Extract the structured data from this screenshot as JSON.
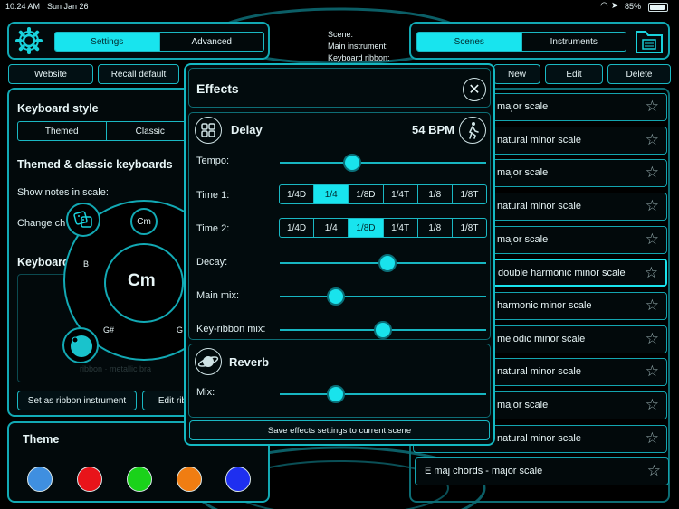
{
  "status_bar": {
    "time": "10:24 AM",
    "date": "Sun Jan 26",
    "battery": "85%"
  },
  "top_left": {
    "tabs": [
      "Settings",
      "Advanced"
    ],
    "active_tab": "Settings",
    "website_label": "Website",
    "recall_label": "Recall default"
  },
  "scene_info": {
    "scene": "Scene:",
    "main_instrument": "Main instrument:",
    "keyboard_ribbon": "Keyboard ribbon:"
  },
  "top_right": {
    "tabs": [
      "Scenes",
      "Instruments"
    ],
    "active_tab": "Scenes",
    "new_label": "New",
    "edit_label": "Edit",
    "delete_label": "Delete"
  },
  "left_panel": {
    "keyboard_style_heading": "Keyboard style",
    "style_options": [
      "Themed",
      "Classic"
    ],
    "themed_heading": "Themed & classic keyboards",
    "show_notes_label": "Show notes in scale:",
    "change_label": "Change ch",
    "keyboard_heading": "Keyboard",
    "ribbon_button": "Set as ribbon instrument",
    "edit_button": "Edit rib",
    "faint_text": "ribbon · metallic bra",
    "theme_heading": "Theme",
    "theme_colors": [
      "#3f8fe0",
      "#e8141a",
      "#1ad21a",
      "#f07d12",
      "#1e2ff0"
    ]
  },
  "chord_wheel": {
    "center": "Cm",
    "top": "Cm",
    "left": "B",
    "bottom_left": "G#",
    "right": "G"
  },
  "effects": {
    "title": "Effects",
    "delay": {
      "title": "Delay",
      "bpm": "54 BPM",
      "tempo_label": "Tempo:",
      "tempo_value": 0.35,
      "time1_label": "Time 1:",
      "time2_label": "Time 2:",
      "time_options": [
        "1/4D",
        "1/4",
        "1/8D",
        "1/4T",
        "1/8",
        "1/8T"
      ],
      "time1_selected": "1/4",
      "time2_selected": "1/8D",
      "decay_label": "Decay:",
      "decay_value": 0.52,
      "main_mix_label": "Main mix:",
      "main_mix_value": 0.27,
      "key_ribbon_label": "Key-ribbon mix:",
      "key_ribbon_value": 0.5
    },
    "reverb": {
      "title": "Reverb",
      "mix_label": "Mix:",
      "mix_value": 0.27
    },
    "save_label": "Save effects settings to current scene"
  },
  "scenes": [
    {
      "text": "major scale",
      "selected": false
    },
    {
      "text": "natural minor scale",
      "selected": false
    },
    {
      "text": "major scale",
      "selected": false
    },
    {
      "text": "natural minor scale",
      "selected": false
    },
    {
      "text": "major scale",
      "selected": false
    },
    {
      "text": "double harmonic minor scale",
      "selected": true
    },
    {
      "text": "harmonic minor scale",
      "selected": false
    },
    {
      "text": "melodic minor scale",
      "selected": false
    },
    {
      "text": "natural minor scale",
      "selected": false
    },
    {
      "text": "major scale",
      "selected": false
    },
    {
      "text": "natural minor scale",
      "selected": false
    },
    {
      "text": "E maj chords  - major scale",
      "selected": false
    }
  ],
  "colors": {
    "accent": "#19e3ec",
    "border": "#12a9b4",
    "background": "#000000"
  }
}
